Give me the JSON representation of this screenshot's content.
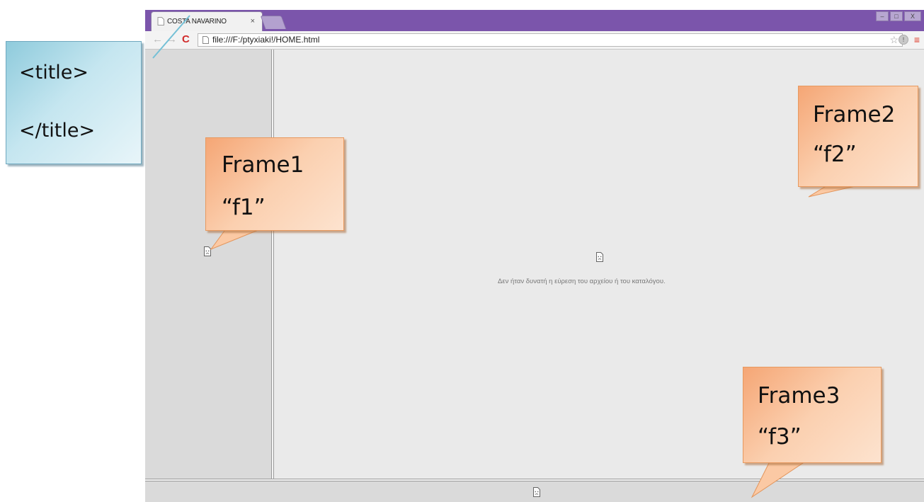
{
  "browser": {
    "tab_title": "COSTA NAVARINO",
    "tab_close": "×",
    "url": "file:///F:/ptyxiaki!/HOME.html",
    "window_buttons": [
      "–",
      "□",
      "X"
    ]
  },
  "frame2": {
    "error_message": "Δεν ήταν δυνατή η εύρεση του αρχείου ή του καταλόγου."
  },
  "annotations": {
    "title_open": "<title>",
    "title_close": "</title>",
    "frame1": "Frame1",
    "frame1_name": "“f1”",
    "frame2": "Frame2",
    "frame2_name": "“f2”",
    "frame3": "Frame3",
    "frame3_name": "“f3”"
  },
  "colors": {
    "titlebar": "#7b55ab",
    "callout_blue": "#c5e6f0",
    "callout_orange": "#fbd0b0"
  }
}
